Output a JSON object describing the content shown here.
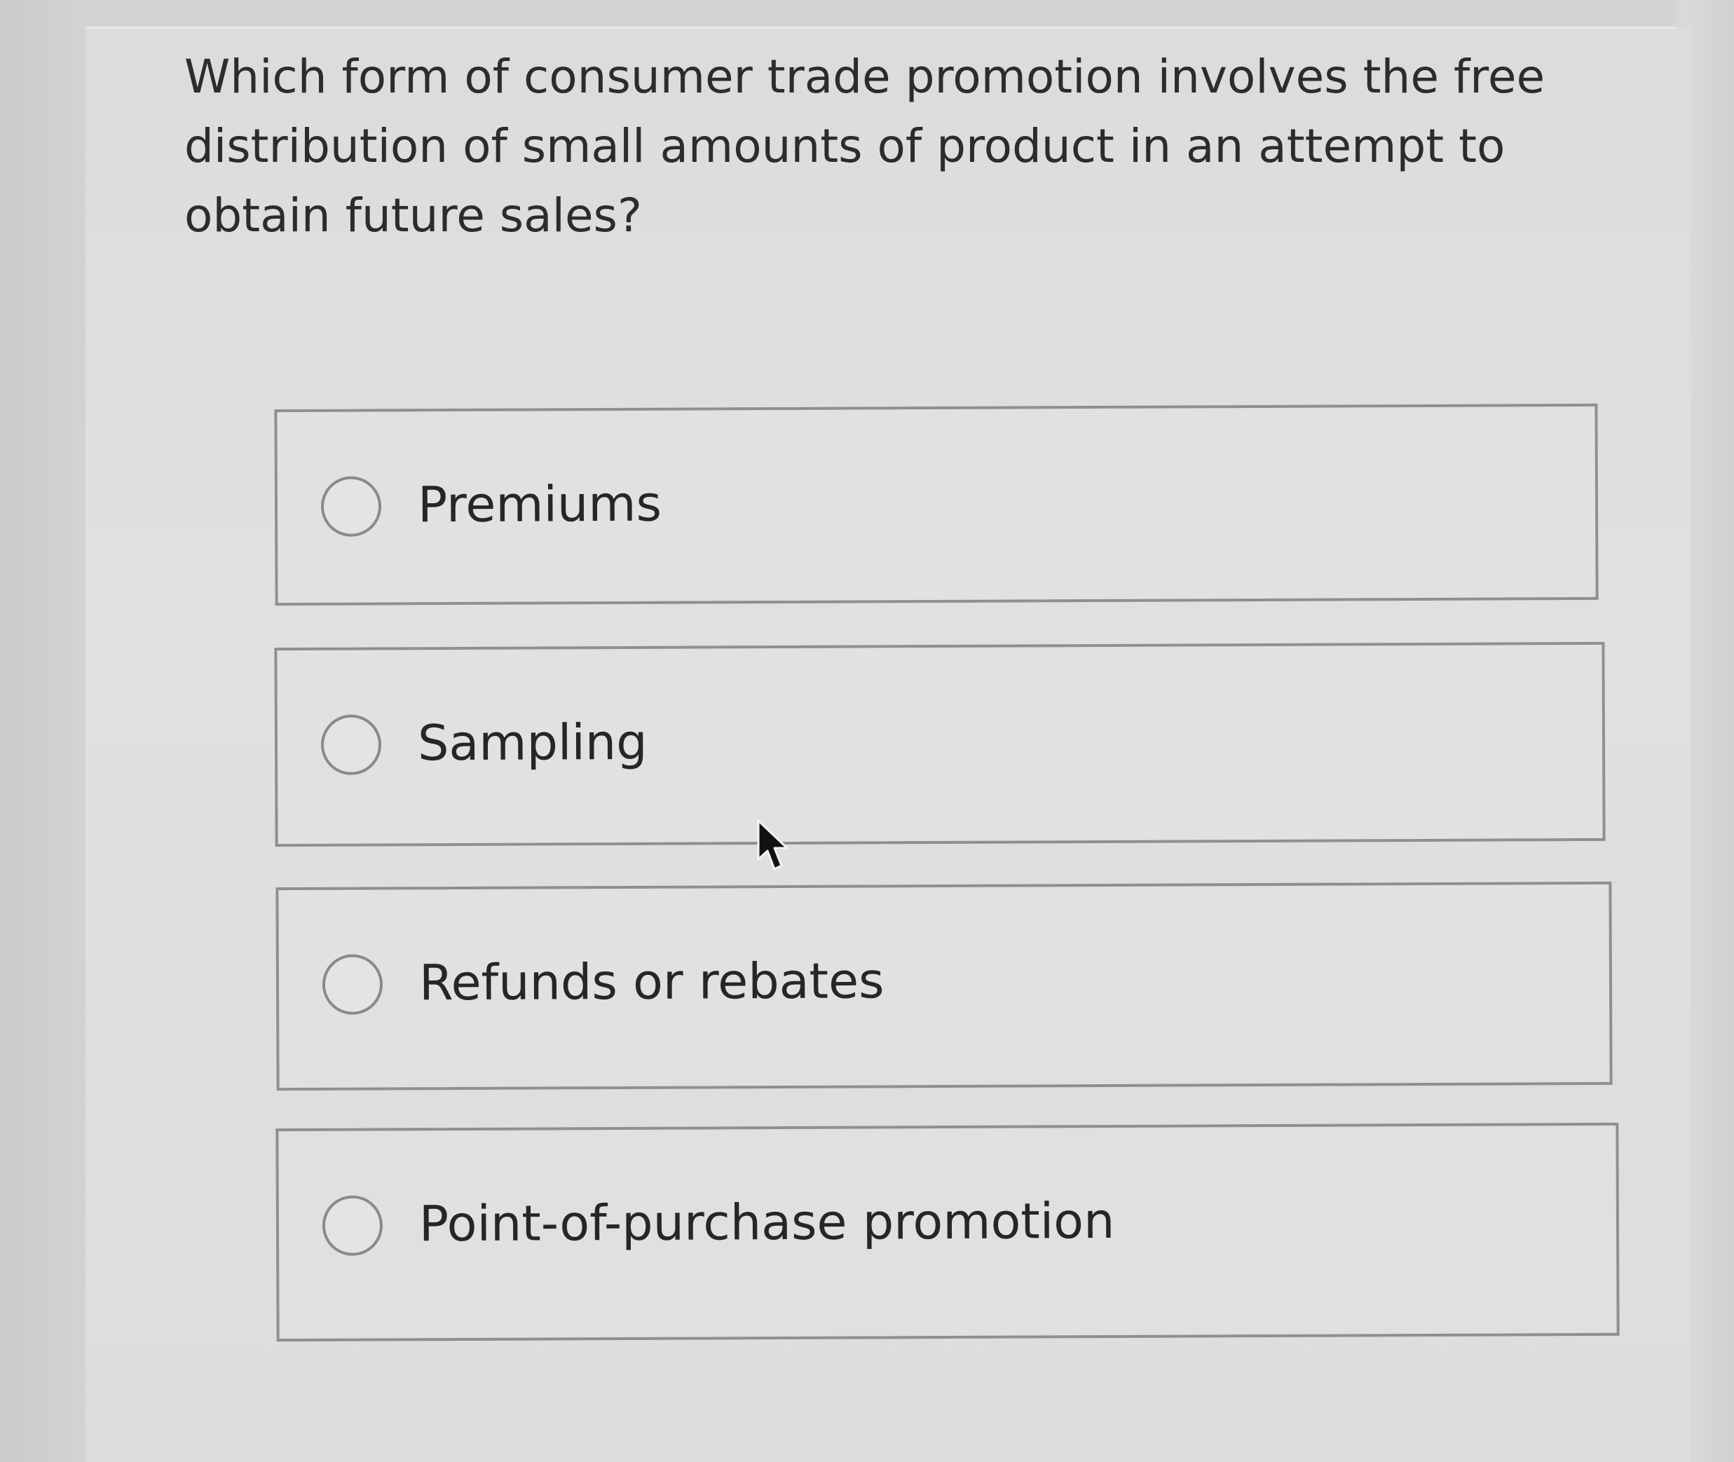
{
  "question": {
    "text": "Which form of consumer trade promotion involves the free distribution of small amounts of product in an attempt to obtain future sales?"
  },
  "choices": [
    {
      "label": "Premiums",
      "selected": false
    },
    {
      "label": "Sampling",
      "selected": false
    },
    {
      "label": "Refunds or rebates",
      "selected": false
    },
    {
      "label": "Point-of-purchase promotion",
      "selected": false
    }
  ],
  "cursor": {
    "icon": "mouse-pointer-icon"
  }
}
